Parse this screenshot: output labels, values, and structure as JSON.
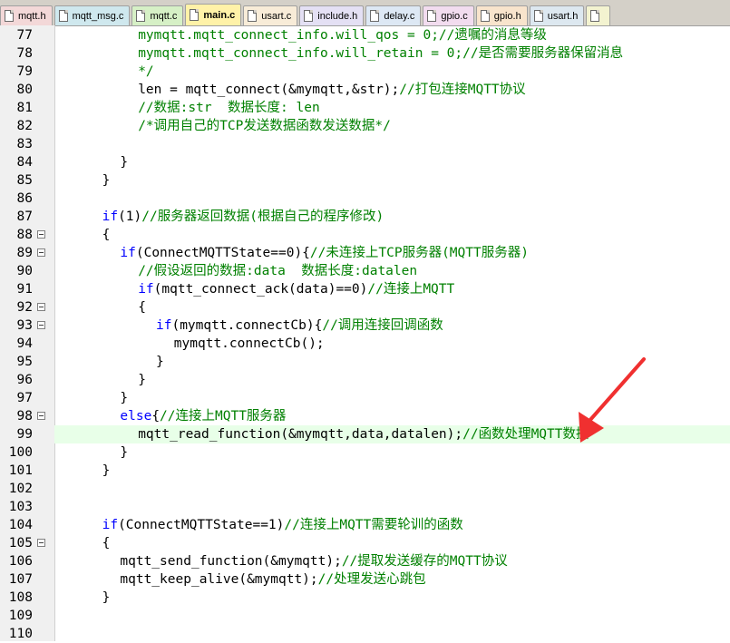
{
  "tabs": [
    {
      "label": "mqtt.h",
      "bg": "#f3d8d8",
      "active": false
    },
    {
      "label": "mqtt_msg.c",
      "bg": "#cfe8ee",
      "active": false
    },
    {
      "label": "mqtt.c",
      "bg": "#d6f0c6",
      "active": false
    },
    {
      "label": "main.c",
      "bg": "#fff2a8",
      "active": true
    },
    {
      "label": "usart.c",
      "bg": "#f8ecd8",
      "active": false
    },
    {
      "label": "include.h",
      "bg": "#e4e0f4",
      "active": false
    },
    {
      "label": "delay.c",
      "bg": "#dde8f4",
      "active": false
    },
    {
      "label": "gpio.c",
      "bg": "#f2dcef",
      "active": false
    },
    {
      "label": "gpio.h",
      "bg": "#f8e4cc",
      "active": false
    },
    {
      "label": "usart.h",
      "bg": "#dde8f0",
      "active": false
    },
    {
      "label": "",
      "bg": "#f3f3d0",
      "active": false
    }
  ],
  "editor": {
    "highlight_color": "#e8ffe8",
    "lines": [
      {
        "num": "77",
        "fold": false,
        "highlight": false,
        "indent": 8,
        "segs": [
          {
            "t": "mymqtt.mqtt_connect_info.will_qos = 0;//遗嘱的消息等级",
            "c": "comment"
          }
        ]
      },
      {
        "num": "78",
        "fold": false,
        "highlight": false,
        "indent": 8,
        "segs": [
          {
            "t": "mymqtt.mqtt_connect_info.will_retain = 0;//是否需要服务器保留消息",
            "c": "comment"
          }
        ]
      },
      {
        "num": "79",
        "fold": false,
        "highlight": false,
        "indent": 8,
        "segs": [
          {
            "t": "*/",
            "c": "comment"
          }
        ]
      },
      {
        "num": "80",
        "fold": false,
        "highlight": false,
        "indent": 8,
        "segs": [
          {
            "t": "len = mqtt_connect(&mymqtt,&str);",
            "c": "text"
          },
          {
            "t": "//打包连接MQTT协议",
            "c": "comment"
          }
        ]
      },
      {
        "num": "81",
        "fold": false,
        "highlight": false,
        "indent": 8,
        "segs": [
          {
            "t": "//数据:str  数据长度: len",
            "c": "comment"
          }
        ]
      },
      {
        "num": "82",
        "fold": false,
        "highlight": false,
        "indent": 8,
        "segs": [
          {
            "t": "/*调用自己的TCP发送数据函数发送数据*/",
            "c": "comment"
          }
        ]
      },
      {
        "num": "83",
        "fold": false,
        "highlight": false,
        "indent": 0,
        "segs": []
      },
      {
        "num": "84",
        "fold": false,
        "highlight": false,
        "indent": 6,
        "segs": [
          {
            "t": "}",
            "c": "text"
          }
        ]
      },
      {
        "num": "85",
        "fold": false,
        "highlight": false,
        "indent": 4,
        "segs": [
          {
            "t": "}",
            "c": "text"
          }
        ]
      },
      {
        "num": "86",
        "fold": false,
        "highlight": false,
        "indent": 0,
        "segs": []
      },
      {
        "num": "87",
        "fold": false,
        "highlight": false,
        "indent": 4,
        "segs": [
          {
            "t": "if",
            "c": "kw"
          },
          {
            "t": "(1)",
            "c": "text"
          },
          {
            "t": "//服务器返回数据(根据自己的程序修改)",
            "c": "comment"
          }
        ]
      },
      {
        "num": "88",
        "fold": true,
        "highlight": false,
        "indent": 4,
        "segs": [
          {
            "t": "{",
            "c": "text"
          }
        ]
      },
      {
        "num": "89",
        "fold": true,
        "highlight": false,
        "indent": 6,
        "segs": [
          {
            "t": "if",
            "c": "kw"
          },
          {
            "t": "(ConnectMQTTState==0){",
            "c": "text"
          },
          {
            "t": "//未连接上TCP服务器(MQTT服务器)",
            "c": "comment"
          }
        ]
      },
      {
        "num": "90",
        "fold": false,
        "highlight": false,
        "indent": 8,
        "segs": [
          {
            "t": "//假设返回的数据:data  数据长度:datalen",
            "c": "comment"
          }
        ]
      },
      {
        "num": "91",
        "fold": false,
        "highlight": false,
        "indent": 8,
        "segs": [
          {
            "t": "if",
            "c": "kw"
          },
          {
            "t": "(mqtt_connect_ack(data)==0)",
            "c": "text"
          },
          {
            "t": "//连接上MQTT",
            "c": "comment"
          }
        ]
      },
      {
        "num": "92",
        "fold": true,
        "highlight": false,
        "indent": 8,
        "segs": [
          {
            "t": "{",
            "c": "text"
          }
        ]
      },
      {
        "num": "93",
        "fold": true,
        "highlight": false,
        "indent": 10,
        "segs": [
          {
            "t": "if",
            "c": "kw"
          },
          {
            "t": "(mymqtt.connectCb){",
            "c": "text"
          },
          {
            "t": "//调用连接回调函数",
            "c": "comment"
          }
        ]
      },
      {
        "num": "94",
        "fold": false,
        "highlight": false,
        "indent": 12,
        "segs": [
          {
            "t": "mymqtt.connectCb();",
            "c": "text"
          }
        ]
      },
      {
        "num": "95",
        "fold": false,
        "highlight": false,
        "indent": 10,
        "segs": [
          {
            "t": "}",
            "c": "text"
          }
        ]
      },
      {
        "num": "96",
        "fold": false,
        "highlight": false,
        "indent": 8,
        "segs": [
          {
            "t": "}",
            "c": "text"
          }
        ]
      },
      {
        "num": "97",
        "fold": false,
        "highlight": false,
        "indent": 6,
        "segs": [
          {
            "t": "}",
            "c": "text"
          }
        ]
      },
      {
        "num": "98",
        "fold": true,
        "highlight": false,
        "indent": 6,
        "segs": [
          {
            "t": "else",
            "c": "kw"
          },
          {
            "t": "{",
            "c": "text"
          },
          {
            "t": "//连接上MQTT服务器",
            "c": "comment"
          }
        ]
      },
      {
        "num": "99",
        "fold": false,
        "highlight": true,
        "indent": 8,
        "segs": [
          {
            "t": "mqtt_read_function(&mymqtt,data,datalen);",
            "c": "text"
          },
          {
            "t": "//函数处理MQTT数据",
            "c": "comment"
          }
        ]
      },
      {
        "num": "100",
        "fold": false,
        "highlight": false,
        "indent": 6,
        "segs": [
          {
            "t": "}",
            "c": "text"
          }
        ]
      },
      {
        "num": "101",
        "fold": false,
        "highlight": false,
        "indent": 4,
        "segs": [
          {
            "t": "}",
            "c": "text"
          }
        ]
      },
      {
        "num": "102",
        "fold": false,
        "highlight": false,
        "indent": 0,
        "segs": []
      },
      {
        "num": "103",
        "fold": false,
        "highlight": false,
        "indent": 0,
        "segs": []
      },
      {
        "num": "104",
        "fold": false,
        "highlight": false,
        "indent": 4,
        "segs": [
          {
            "t": "if",
            "c": "kw"
          },
          {
            "t": "(ConnectMQTTState==1)",
            "c": "text"
          },
          {
            "t": "//连接上MQTT需要轮训的函数",
            "c": "comment"
          }
        ]
      },
      {
        "num": "105",
        "fold": true,
        "highlight": false,
        "indent": 4,
        "segs": [
          {
            "t": "{",
            "c": "text"
          }
        ]
      },
      {
        "num": "106",
        "fold": false,
        "highlight": false,
        "indent": 6,
        "segs": [
          {
            "t": "mqtt_send_function(&mymqtt);",
            "c": "text"
          },
          {
            "t": "//提取发送缓存的MQTT协议",
            "c": "comment"
          }
        ]
      },
      {
        "num": "107",
        "fold": false,
        "highlight": false,
        "indent": 6,
        "segs": [
          {
            "t": "mqtt_keep_alive(&mymqtt);",
            "c": "text"
          },
          {
            "t": "//处理发送心跳包",
            "c": "comment"
          }
        ]
      },
      {
        "num": "108",
        "fold": false,
        "highlight": false,
        "indent": 4,
        "segs": [
          {
            "t": "}",
            "c": "text"
          }
        ]
      },
      {
        "num": "109",
        "fold": false,
        "highlight": false,
        "indent": 0,
        "segs": []
      },
      {
        "num": "110",
        "fold": false,
        "highlight": false,
        "indent": 0,
        "segs": []
      }
    ]
  },
  "annotation": {
    "arrow_color": "#f03030"
  }
}
